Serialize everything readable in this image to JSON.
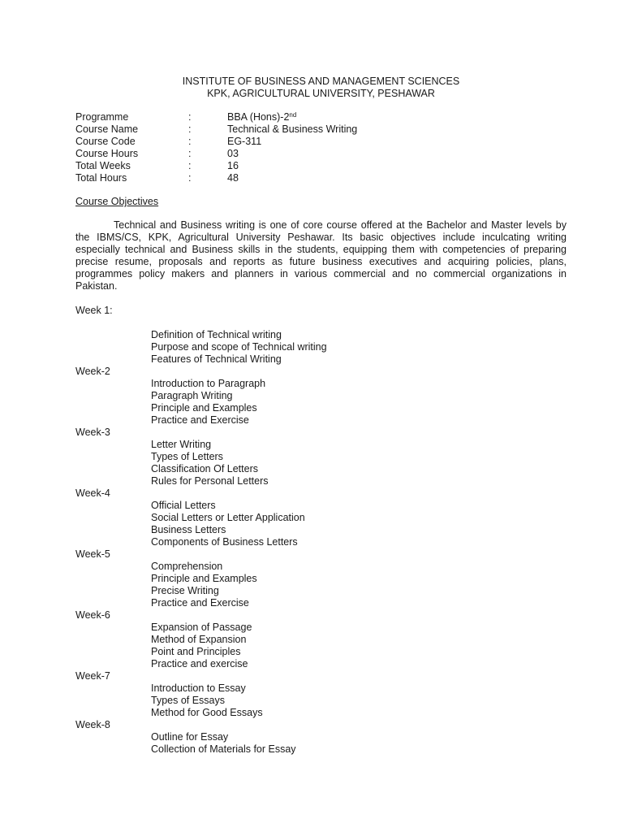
{
  "header": {
    "line1": "INSTITUTE OF BUSINESS AND MANAGEMENT SCIENCES",
    "line2": "KPK, AGRICULTURAL UNIVERSITY, PESHAWAR"
  },
  "meta": [
    {
      "label": "Programme",
      "colon": ":",
      "value": "BBA (Hons)-2",
      "sup": "nd"
    },
    {
      "label": "Course Name",
      "colon": ":",
      "value": "Technical & Business Writing"
    },
    {
      "label": "Course Code",
      "colon": ":",
      "value": "EG-311"
    },
    {
      "label": "Course Hours",
      "colon": ":",
      "value": "03"
    },
    {
      "label": "Total Weeks",
      "colon": ":",
      "value": "16"
    },
    {
      "label": "Total Hours",
      "colon": ":",
      "value": "48"
    }
  ],
  "objectives": {
    "heading": "Course Objectives",
    "text": "Technical and Business writing is one of core course offered at the Bachelor and Master levels by the IBMS/CS, KPK, Agricultural University  Peshawar. Its basic objectives include inculcating writing especially technical and Business skills in the students, equipping them with  competencies of preparing precise resume, proposals and reports as future business executives and acquiring policies, plans, programmes policy makers and planners in various commercial and no commercial organizations in Pakistan."
  },
  "weeks": [
    {
      "label": "Week 1:",
      "topics": [
        "Definition of Technical writing",
        "Purpose and scope of Technical writing",
        "Features of Technical Writing"
      ]
    },
    {
      "label": "Week-2",
      "topics": [
        "Introduction to Paragraph",
        "Paragraph Writing",
        "Principle and Examples",
        "Practice and Exercise"
      ]
    },
    {
      "label": "Week-3",
      "topics": [
        "Letter Writing",
        "Types of Letters",
        "Classification Of Letters",
        "Rules for Personal Letters"
      ]
    },
    {
      "label": "Week-4",
      "topics": [
        "Official Letters",
        "Social Letters or Letter Application",
        "Business Letters",
        "Components of Business Letters"
      ]
    },
    {
      "label": "Week-5",
      "topics": [
        "Comprehension",
        "Principle and Examples",
        "Precise Writing",
        "Practice and Exercise"
      ]
    },
    {
      "label": "Week-6",
      "topics": [
        "Expansion of Passage",
        "Method of Expansion",
        "Point and Principles",
        "Practice and exercise"
      ]
    },
    {
      "label": "Week-7",
      "topics": [
        "Introduction to Essay",
        "Types of Essays",
        "Method for Good Essays"
      ]
    },
    {
      "label": "Week-8",
      "topics": [
        "Outline for Essay",
        "Collection of Materials for Essay"
      ]
    }
  ]
}
